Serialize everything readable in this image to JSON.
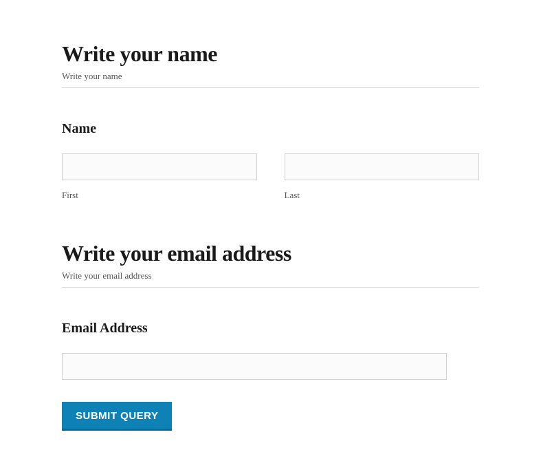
{
  "section1": {
    "heading": "Write your name",
    "subtext": "Write your name",
    "field_label": "Name",
    "first_value": "",
    "first_label": "First",
    "last_value": "",
    "last_label": "Last"
  },
  "section2": {
    "heading": "Write your email address",
    "subtext": "Write your email address",
    "field_label": "Email Address",
    "email_value": ""
  },
  "form": {
    "submit_label": "SUBMIT QUERY"
  }
}
